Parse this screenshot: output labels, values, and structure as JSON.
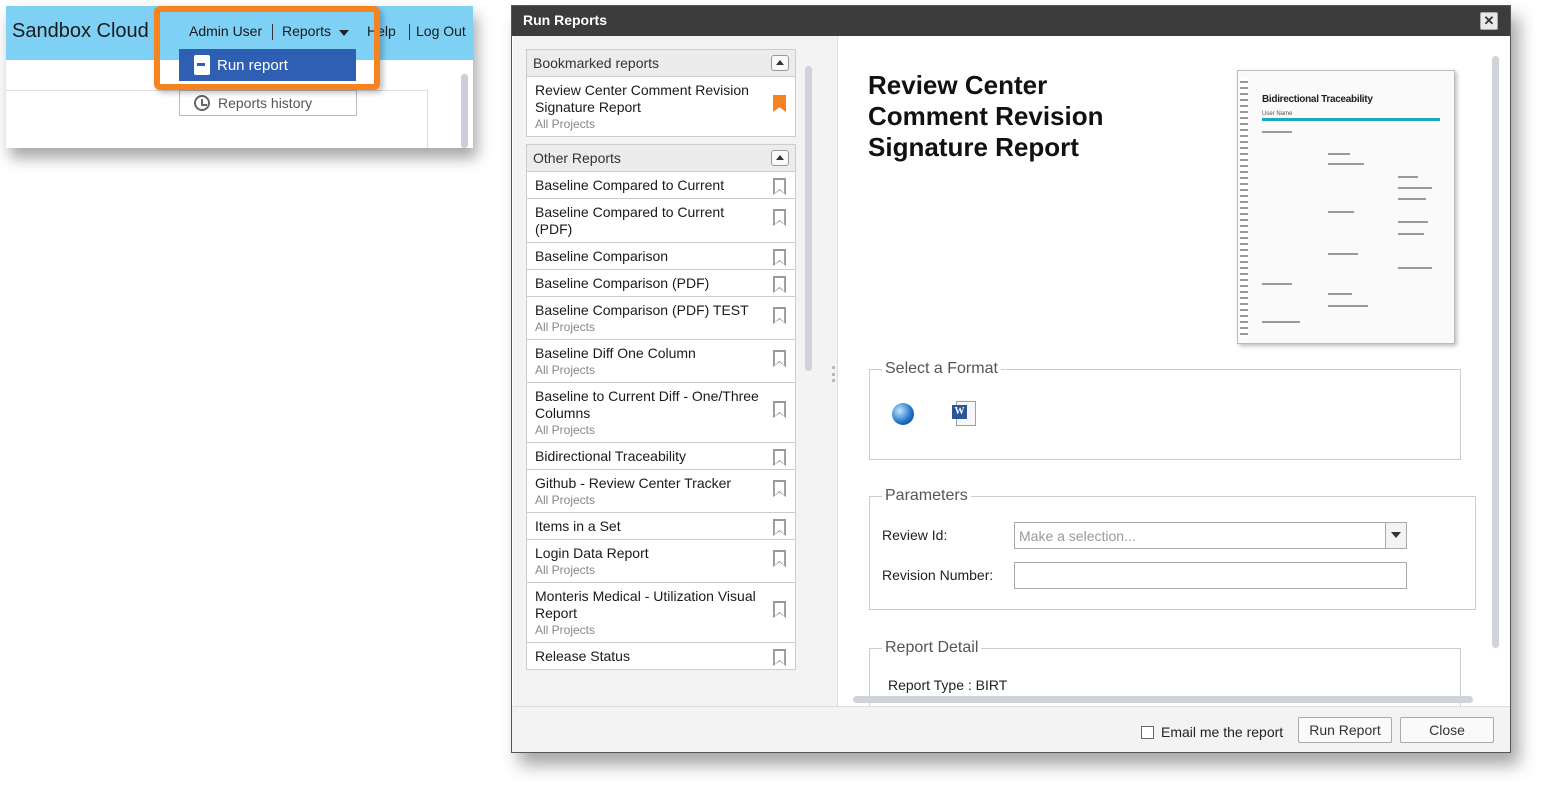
{
  "app": {
    "title": "Sandbox Cloud",
    "nav": {
      "admin": "Admin User",
      "reports": "Reports",
      "help": "Help",
      "logout": "Log Out"
    },
    "dropdown": {
      "run_report": "Run report"
    },
    "reports_history": "Reports history",
    "highlight_color": "#f7831e",
    "header_color": "#7fd0f5"
  },
  "dialog": {
    "title": "Run Reports",
    "close_glyph": "✕",
    "bookmarked": {
      "header": "Bookmarked reports",
      "items": [
        {
          "name": "Review Center Comment Revision Signature Report",
          "sub": "All Projects",
          "bookmarked": true
        }
      ]
    },
    "other": {
      "header": "Other Reports",
      "items": [
        {
          "name": "Baseline Compared to Current",
          "sub": ""
        },
        {
          "name": "Baseline Compared to Current (PDF)",
          "sub": ""
        },
        {
          "name": "Baseline Comparison",
          "sub": ""
        },
        {
          "name": "Baseline Comparison (PDF)",
          "sub": ""
        },
        {
          "name": "Baseline Comparison (PDF) TEST",
          "sub": "All Projects"
        },
        {
          "name": "Baseline Diff One Column",
          "sub": "All Projects"
        },
        {
          "name": "Baseline to Current Diff - One/Three Columns",
          "sub": "All Projects"
        },
        {
          "name": "Bidirectional Traceability",
          "sub": ""
        },
        {
          "name": "Github - Review Center Tracker",
          "sub": "All Projects"
        },
        {
          "name": "Items in a Set",
          "sub": ""
        },
        {
          "name": "Login Data Report",
          "sub": "All Projects"
        },
        {
          "name": "Monteris Medical - Utilization Visual Report",
          "sub": "All Projects"
        },
        {
          "name": "Release Status",
          "sub": ""
        }
      ]
    },
    "detail": {
      "title": "Review Center Comment Revision Signature Report",
      "thumbnail_title": "Bidirectional Traceability",
      "thumbnail_sub": "User Name",
      "format_legend": "Select a Format",
      "format_icons": [
        "html-globe-icon",
        "word-icon"
      ],
      "params_legend": "Parameters",
      "review_id_label": "Review Id:",
      "review_id_placeholder": "Make a selection...",
      "revision_label": "Revision Number:",
      "revision_value": "",
      "detail_legend": "Report Detail",
      "report_type": "Report Type :  BIRT"
    },
    "footer": {
      "email_label": "Email me the report",
      "email_checked": false,
      "run_button": "Run Report",
      "close_button": "Close"
    }
  }
}
